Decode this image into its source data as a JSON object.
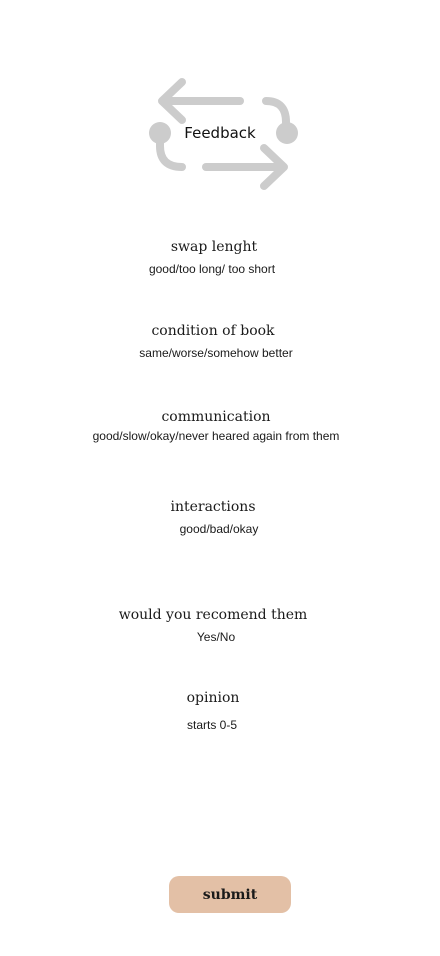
{
  "logo": {
    "text": "Feedback",
    "icon": "swap-arrows-icon",
    "icon_color": "#cccccc"
  },
  "questions": [
    {
      "title": "swap lenght",
      "options": "good/too long/ too short"
    },
    {
      "title": "condition of book",
      "options": "same/worse/somehow better"
    },
    {
      "title": "communication",
      "options": "good/slow/okay/never heared again from them"
    },
    {
      "title": "interactions",
      "options": "good/bad/okay"
    },
    {
      "title": "would you recomend them",
      "options": "Yes/No"
    },
    {
      "title": "opinion",
      "options": "starts 0-5"
    }
  ],
  "submit": {
    "label": "submit",
    "color": "#e3c0a6"
  }
}
